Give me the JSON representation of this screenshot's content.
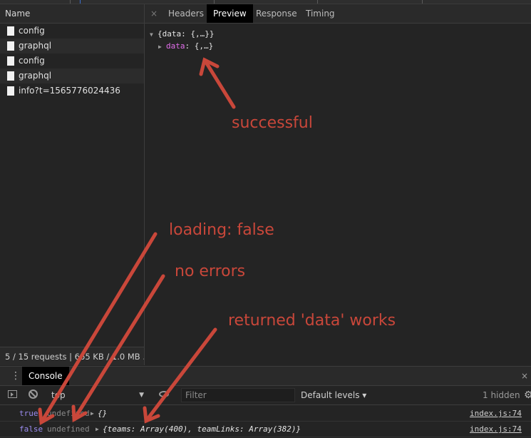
{
  "network": {
    "list_header": "Name",
    "requests": [
      {
        "name": "config"
      },
      {
        "name": "graphql"
      },
      {
        "name": "config"
      },
      {
        "name": "graphql"
      },
      {
        "name": "info?t=1565776024436"
      }
    ],
    "summary": "5 / 15 requests | 665 KB / 1.0 MB ..."
  },
  "detail": {
    "close_glyph": "×",
    "tabs": [
      {
        "label": "Headers"
      },
      {
        "label": "Preview"
      },
      {
        "label": "Response"
      },
      {
        "label": "Timing"
      }
    ],
    "active_tab": "Preview",
    "preview": {
      "root": "{data: {,…}}",
      "child_key": "data",
      "child_value": ": {,…}"
    }
  },
  "drawer": {
    "tab_label": "Console",
    "close_glyph": "×",
    "context": "top",
    "filter_placeholder": "Filter",
    "levels": "Default levels ▾",
    "hidden": "1 hidden",
    "messages": [
      {
        "bool": "true",
        "undef": "undefined",
        "obj": "{}",
        "src": "index.js:74"
      },
      {
        "bool": "false",
        "undef": "undefined",
        "obj": "{teams: Array(400), teamLinks: Array(382)}",
        "src": "index.js:74"
      }
    ]
  },
  "annotations": {
    "color": "#c9473a",
    "successful": "successful",
    "loading": "loading: false",
    "no_errors": "no errors",
    "returned": "returned 'data' works"
  }
}
